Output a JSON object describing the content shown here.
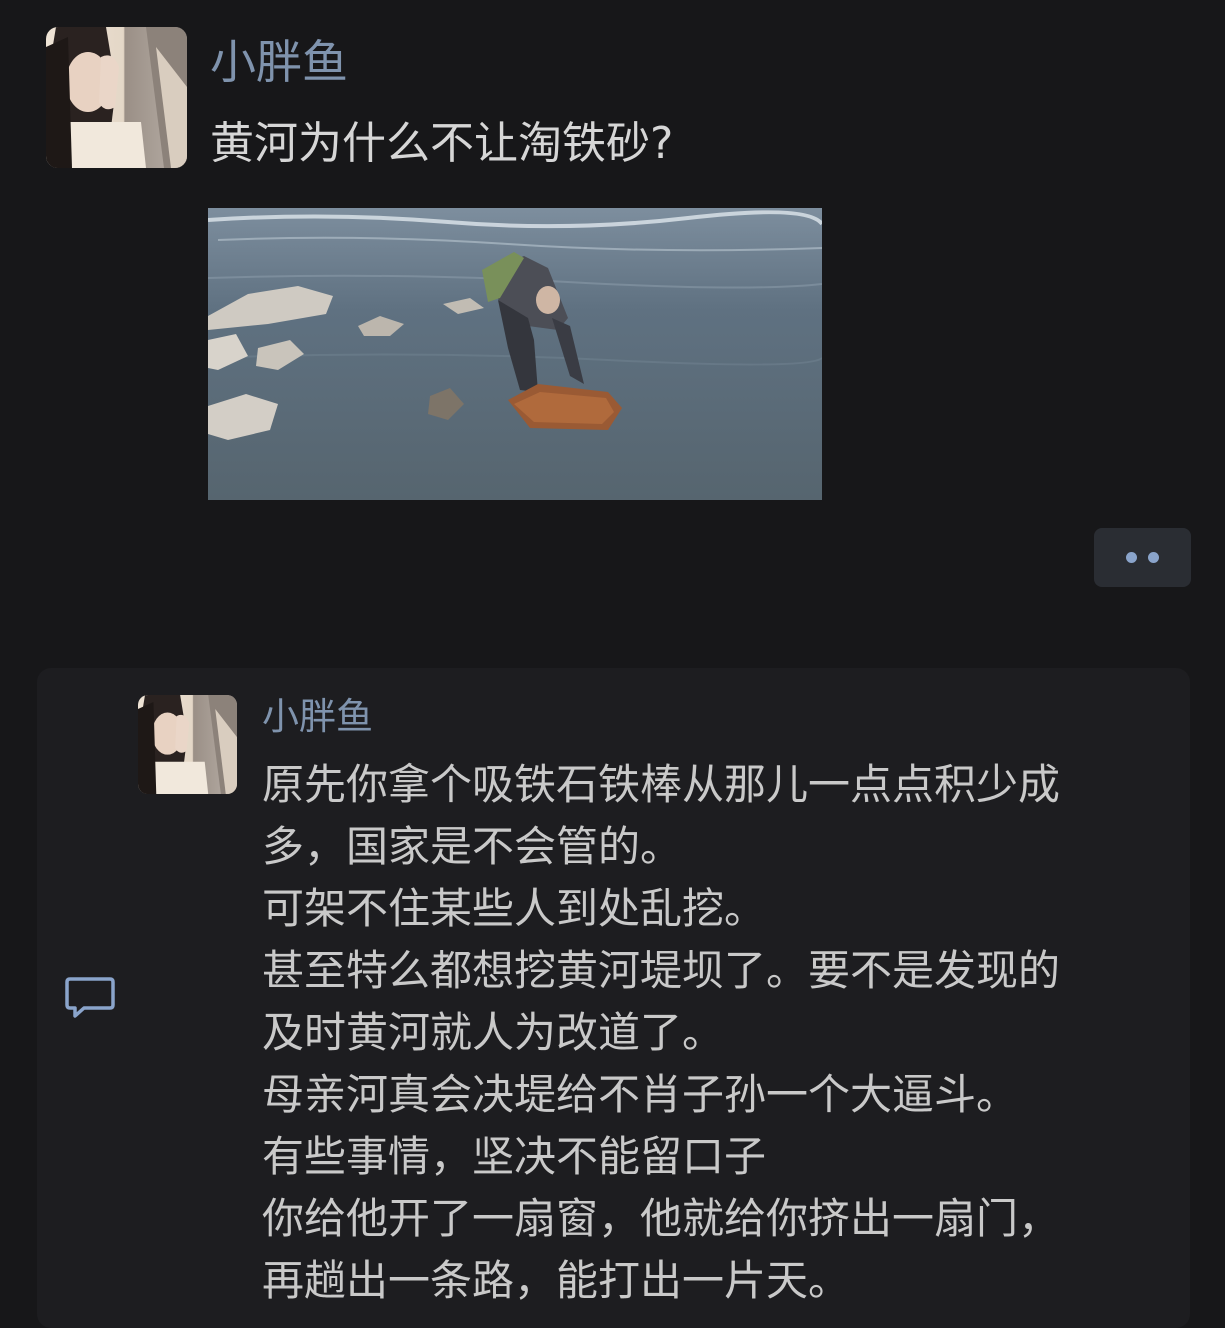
{
  "post": {
    "username": "小胖鱼",
    "text": "黄河为什么不让淘铁砂?",
    "more_icon": "more-dots-icon"
  },
  "comment": {
    "username": "小胖鱼",
    "lines": [
      "原先你拿个吸铁石铁棒从那儿一点点积少成",
      "多，国家是不会管的。",
      "可架不住某些人到处乱挖。",
      "甚至特么都想挖黄河堤坝了。要不是发现的",
      "及时黄河就人为改道了。",
      "母亲河真会决堤给不肖子孙一个大逼斗。",
      "有些事情，坚决不能留口子",
      "你给他开了一扇窗，他就给你挤出一扇门，",
      "再趟出一条路，能打出一片天。"
    ],
    "icon": "comment-bubble-icon"
  },
  "colors": {
    "background": "#171719",
    "username": "#7f93ad",
    "text": "#d6d6d6",
    "accent_dots": "#8aa4cb"
  }
}
